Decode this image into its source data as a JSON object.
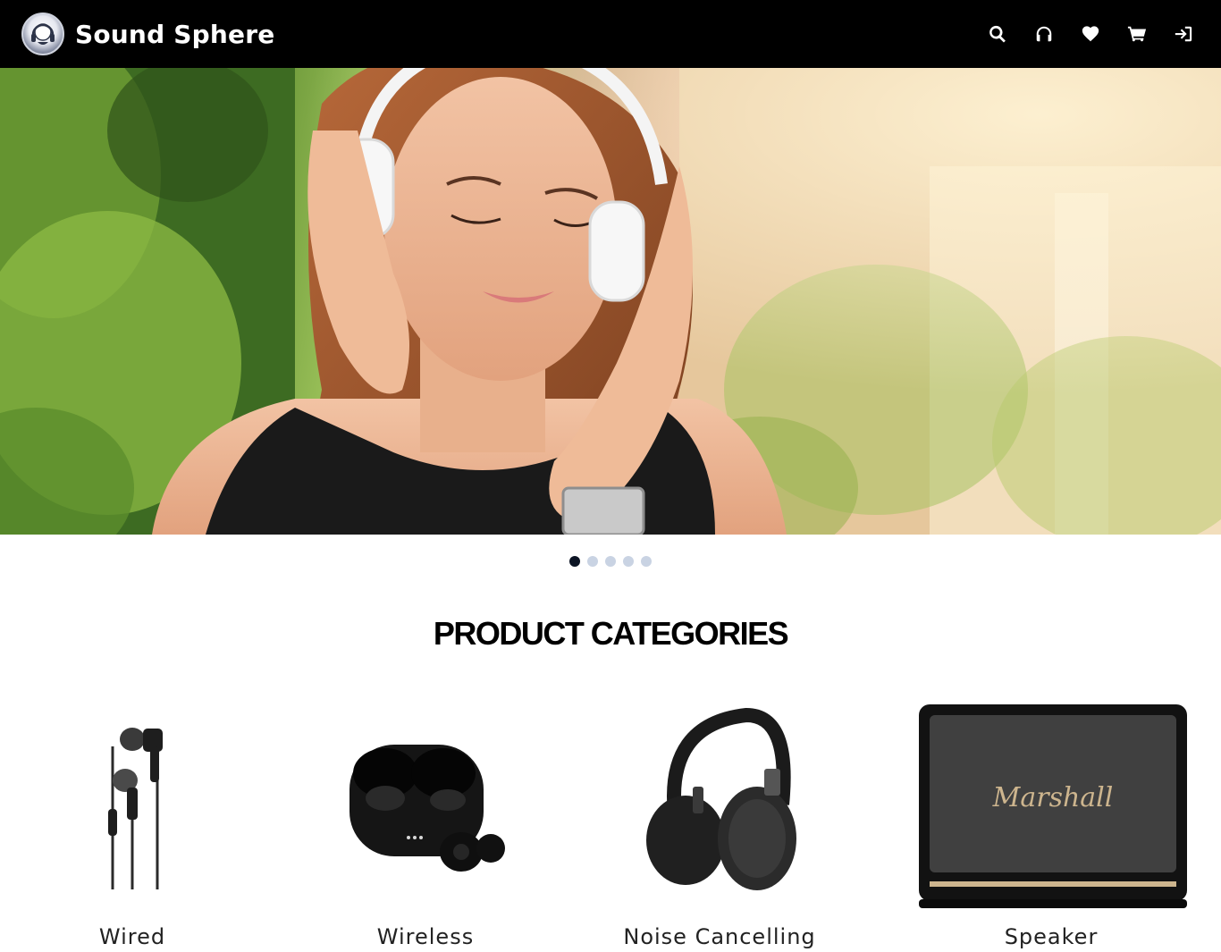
{
  "navbar": {
    "brand_name": "Sound Sphere",
    "logo_icon": "headphones-astronaut-logo",
    "icons": [
      "search-icon",
      "headphones-icon",
      "heart-icon",
      "cart-icon",
      "sign-in-icon"
    ],
    "background": "#000000"
  },
  "hero": {
    "image": "woman-listening-with-white-headphones",
    "carousel_dots": 5,
    "active_dot": 1
  },
  "categories": {
    "title": "PRODUCT CATEGORIES",
    "items": [
      {
        "label": "Wired",
        "image": "wired-earphones"
      },
      {
        "label": "Wireless",
        "image": "wireless-earbuds-case"
      },
      {
        "label": "Noise Cancelling",
        "image": "over-ear-headphones"
      },
      {
        "label": "Speaker",
        "image": "marshall-speaker",
        "brand_text": "Marshall"
      }
    ]
  }
}
